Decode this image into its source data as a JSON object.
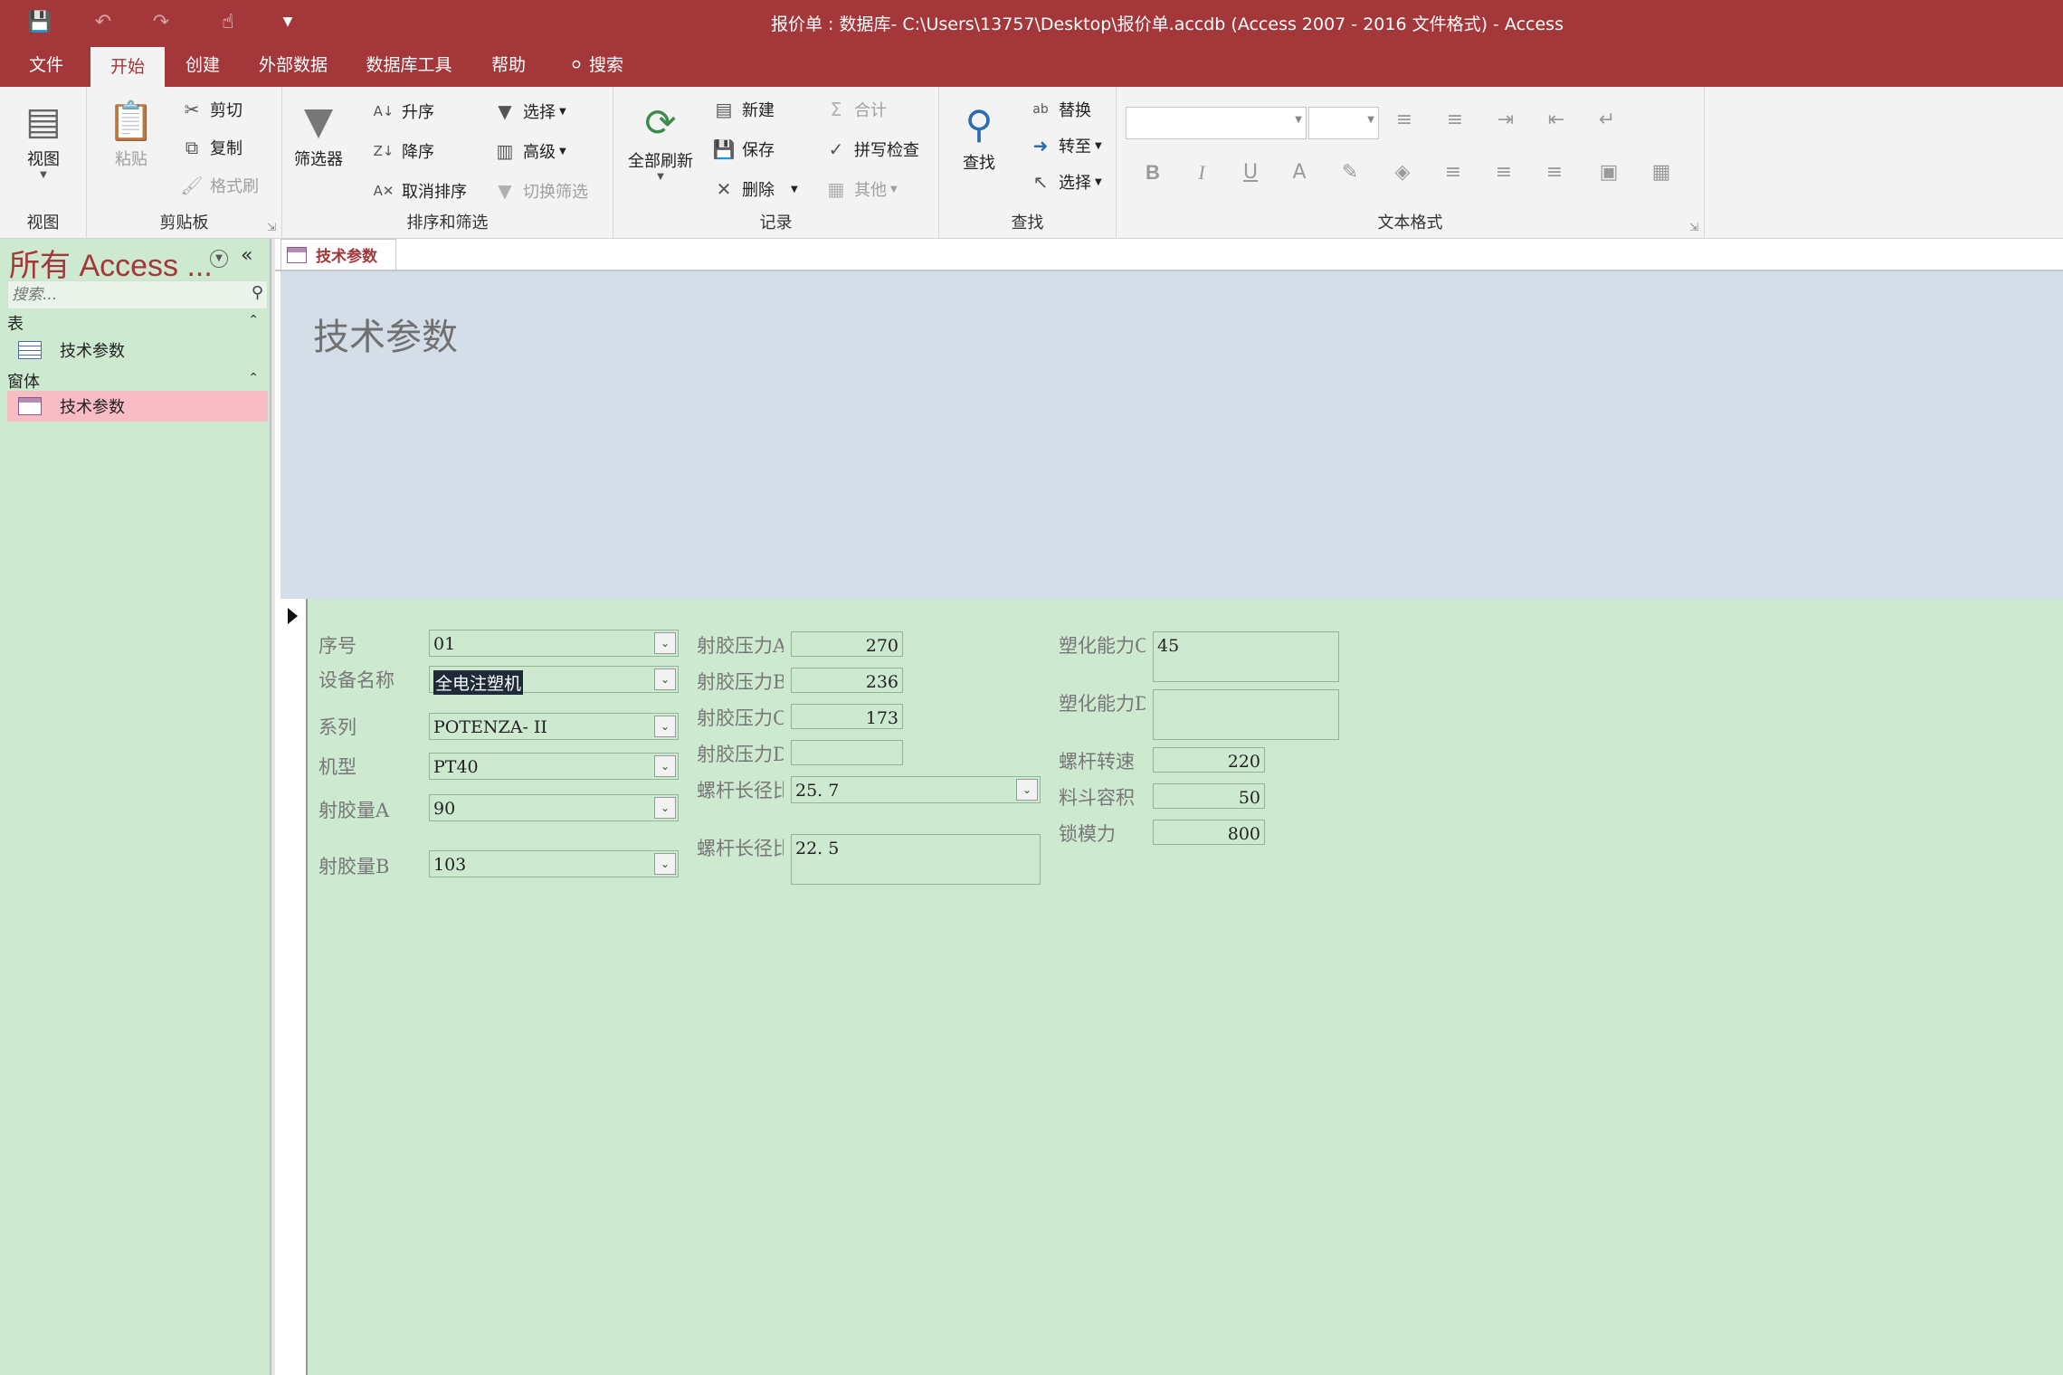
{
  "titlebar": {
    "title": "报价单 : 数据库- C:\\Users\\13757\\Desktop\\报价单.accdb (Access 2007 - 2016 文件格式)  -  Access"
  },
  "tabs": [
    "文件",
    "开始",
    "创建",
    "外部数据",
    "数据库工具",
    "帮助",
    "搜索"
  ],
  "ribbon": {
    "view": {
      "label": "视图",
      "group": "视图"
    },
    "clipboard": {
      "paste": "粘贴",
      "cut": "剪切",
      "copy": "复制",
      "format_painter": "格式刷",
      "group": "剪贴板"
    },
    "sort_filter": {
      "filter": "筛选器",
      "ascending": "升序",
      "descending": "降序",
      "clear_sort": "取消排序",
      "selection": "选择",
      "advanced": "高级",
      "toggle_filter": "切换筛选",
      "group": "排序和筛选"
    },
    "records": {
      "refresh_all": "全部刷新",
      "new": "新建",
      "save": "保存",
      "delete": "删除",
      "totals": "合计",
      "spelling": "拼写检查",
      "more": "其他",
      "group": "记录"
    },
    "find": {
      "find": "查找",
      "replace": "替换",
      "goto": "转至",
      "select": "选择",
      "group": "查找"
    },
    "text_format": {
      "group": "文本格式",
      "bold": "B",
      "italic": "I",
      "underline": "U",
      "font_color": "A"
    }
  },
  "nav": {
    "title": "所有 Access ...",
    "search_placeholder": "搜索...",
    "sections": [
      {
        "label": "表",
        "items": [
          "技术参数"
        ]
      },
      {
        "label": "窗体",
        "items": [
          "技术参数"
        ]
      }
    ]
  },
  "doc_tab": "技术参数",
  "form": {
    "title": "技术参数",
    "col1": [
      {
        "label": "序号",
        "value": "01"
      },
      {
        "label": "设备名称",
        "value": "全电注塑机"
      },
      {
        "label": "系列",
        "value": "POTENZA- II"
      },
      {
        "label": "机型",
        "value": "PT40"
      },
      {
        "label": "射胶量A",
        "value": "90"
      },
      {
        "label": "射胶量B",
        "value": "103"
      }
    ],
    "col2": [
      {
        "label": "射胶压力A",
        "value": "270"
      },
      {
        "label": "射胶压力B",
        "value": "236"
      },
      {
        "label": "射胶压力C",
        "value": "173"
      },
      {
        "label": "射胶压力D",
        "value": ""
      },
      {
        "label": "螺杆长径比",
        "value": "25. 7"
      },
      {
        "label": "螺杆长径比",
        "value": "22. 5"
      }
    ],
    "col3": [
      {
        "label": "塑化能力C",
        "value": "45"
      },
      {
        "label": "塑化能力D",
        "value": ""
      },
      {
        "label": "螺杆转速",
        "value": "220"
      },
      {
        "label": "料斗容积",
        "value": "50"
      },
      {
        "label": "锁模力",
        "value": "800"
      }
    ]
  },
  "colors": {
    "accent": "#a4373a",
    "form_bg": "#cde9d0",
    "header_bg": "#d4dee8",
    "nav_selected": "#f8bcc4"
  }
}
